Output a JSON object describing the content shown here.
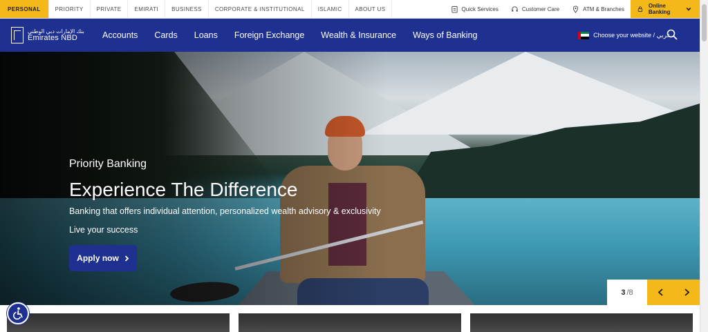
{
  "topbar": {
    "segments": [
      "PERSONAL",
      "PRIORITY",
      "PRIVATE",
      "EMIRATI",
      "BUSINESS",
      "CORPORATE & INSTITUTIONAL",
      "ISLAMIC",
      "ABOUT US"
    ],
    "quick_services": "Quick Services",
    "customer_care": "Customer Care",
    "atm_branches": "ATM & Branches",
    "online_banking": "Online Banking"
  },
  "brand": {
    "name_ar": "بنك الإمارات دبي الوطني",
    "name_en": "Emirates NBD",
    "primary_color": "#1f3190",
    "accent_color": "#f5b819"
  },
  "nav": {
    "links": [
      "Accounts",
      "Cards",
      "Loans",
      "Foreign Exchange",
      "Wealth & Insurance",
      "Ways of Banking"
    ],
    "choose_website": "Choose your website / عربي"
  },
  "hero": {
    "eyebrow": "Priority Banking",
    "headline": "Experience The Difference",
    "subline": "Banking that offers individual attention, personalized wealth advisory & exclusivity",
    "tagline": "Live your success",
    "cta": "Apply now",
    "slide_current": "3",
    "slide_total": "/8"
  },
  "icons": {
    "quick_services": "clipboard-icon",
    "customer_care": "headset-icon",
    "atm_branches": "map-pin-icon",
    "online_banking": "lock-icon",
    "search": "search-icon",
    "accessibility": "accessibility-icon"
  }
}
